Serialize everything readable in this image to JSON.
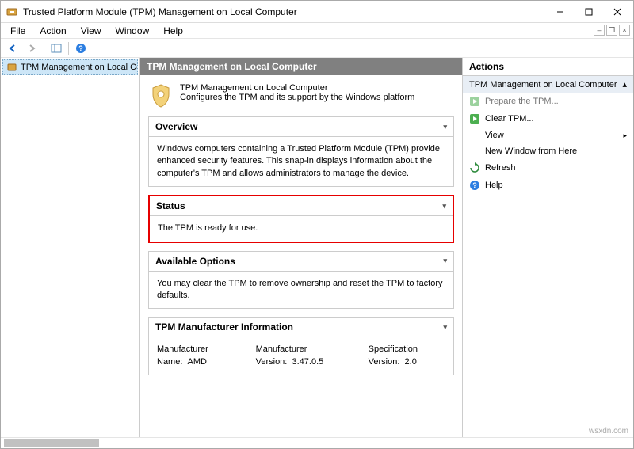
{
  "title": "Trusted Platform Module (TPM) Management on Local Computer",
  "menu": {
    "file": "File",
    "action": "Action",
    "view": "View",
    "window": "Window",
    "help": "Help"
  },
  "tree": {
    "root": "TPM Management on Local Compu"
  },
  "mid": {
    "header": "TPM Management on Local Computer",
    "info_title": "TPM Management on Local Computer",
    "info_sub": "Configures the TPM and its support by the Windows platform",
    "overview_h": "Overview",
    "overview_b": "Windows computers containing a Trusted Platform Module (TPM) provide enhanced security features. This snap-in displays information about the computer's TPM and allows administrators to manage the device.",
    "status_h": "Status",
    "status_b": "The TPM is ready for use.",
    "avail_h": "Available Options",
    "avail_b": "You may clear the TPM to remove ownership and reset the TPM to factory defaults.",
    "mfr_h": "TPM Manufacturer Information",
    "mfr_name_l": "Manufacturer Name:",
    "mfr_name_v": "AMD",
    "mfr_ver_l": "Manufacturer Version:",
    "mfr_ver_v": "3.47.0.5",
    "spec_l": "Specification Version:",
    "spec_v": "2.0"
  },
  "actions": {
    "header": "Actions",
    "group": "TPM Management on Local Computer",
    "prepare": "Prepare the TPM...",
    "clear": "Clear TPM...",
    "view": "View",
    "newwin": "New Window from Here",
    "refresh": "Refresh",
    "help": "Help"
  },
  "watermark": "wsxdn.com"
}
